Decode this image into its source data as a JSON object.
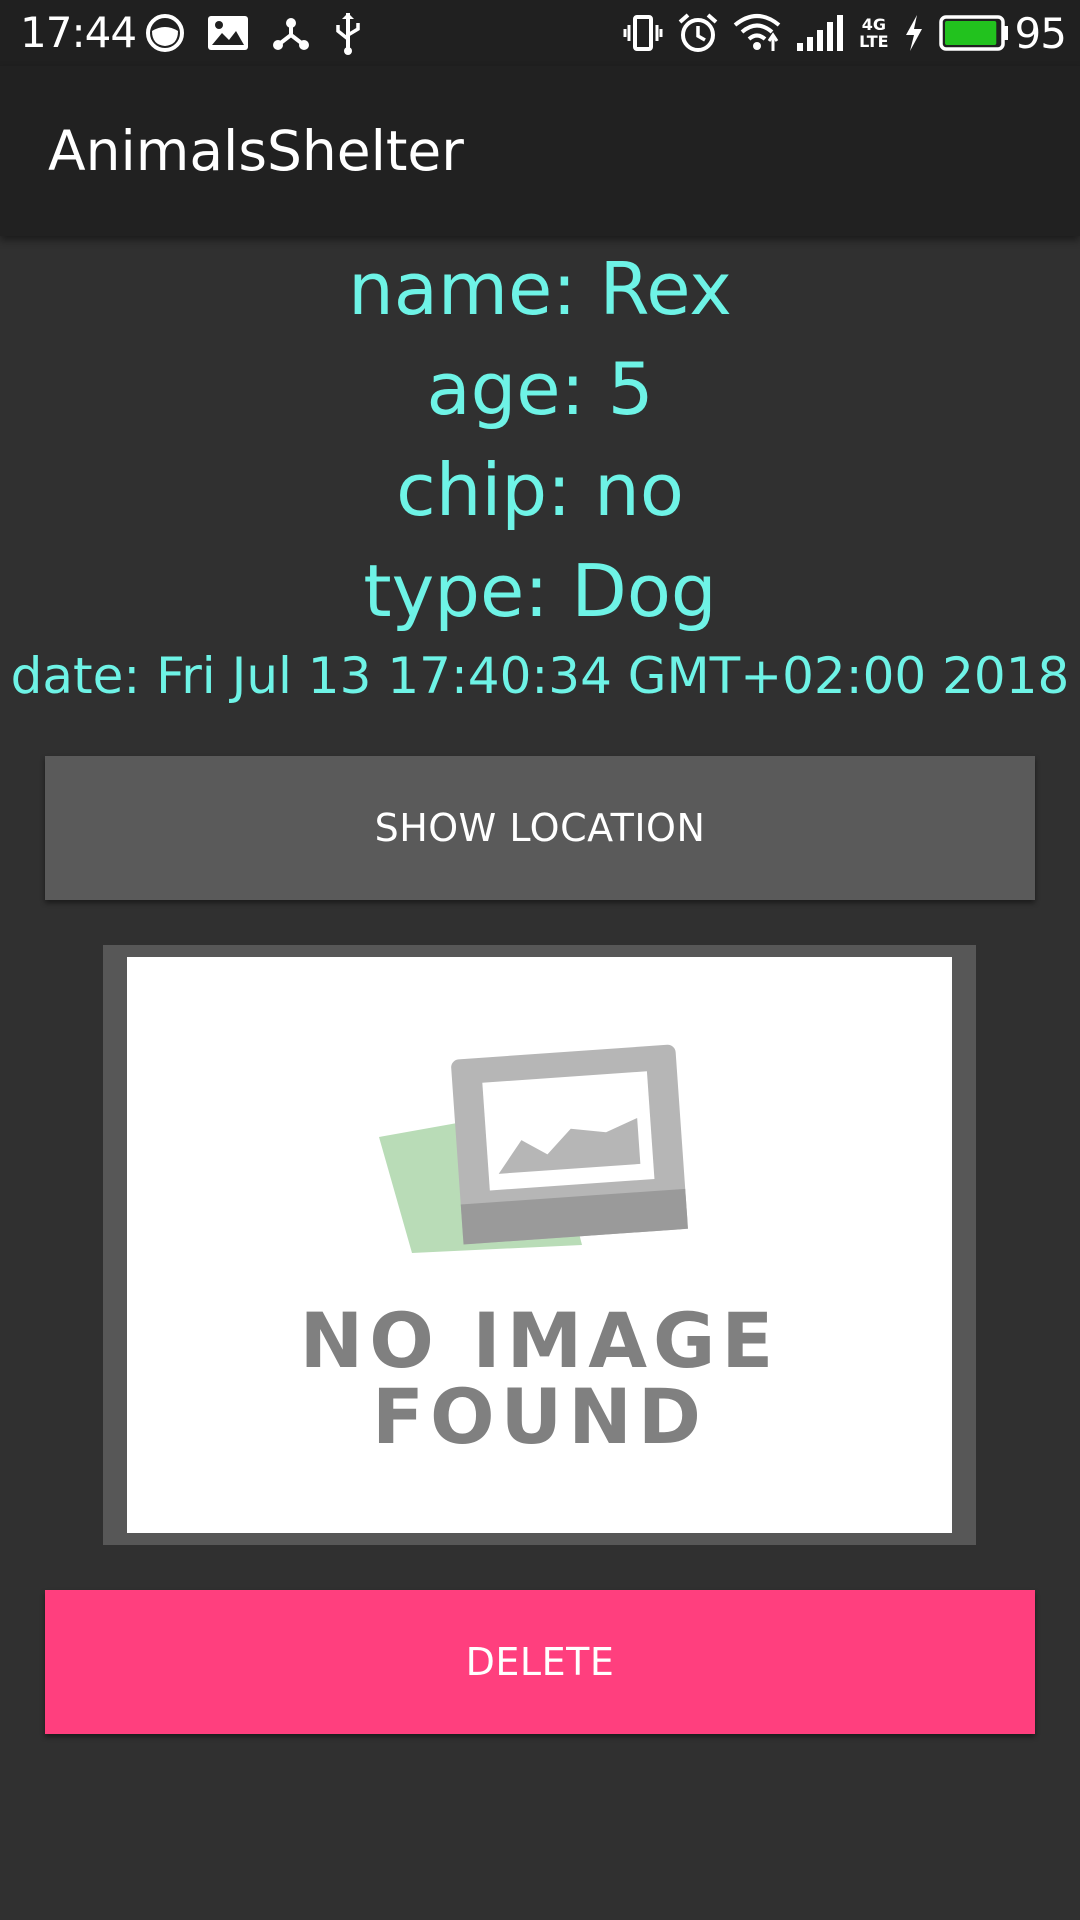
{
  "status_bar": {
    "time": "17:44",
    "battery_percent": "95",
    "left_icons": [
      "mask-icon",
      "image-icon",
      "share-node-icon",
      "usb-icon"
    ],
    "right_icons": [
      "vibrate-icon",
      "alarm-icon",
      "wifi-icon",
      "signal-icon",
      "lte-icon",
      "charging-icon",
      "battery-icon"
    ],
    "network_label_top": "4G",
    "network_label_bottom": "LTE",
    "battery_color": "#22c21e"
  },
  "app_bar": {
    "title": "AnimalsShelter"
  },
  "animal": {
    "name": "name: Rex",
    "age": "age: 5",
    "chip": "chip: no",
    "type": "type: Dog",
    "date": "date: Fri Jul 13 17:40:34 GMT+02:00 2018"
  },
  "actions": {
    "show_location_label": "SHOW LOCATION",
    "delete_label": "DELETE"
  },
  "photo": {
    "placeholder_line1": "NO IMAGE",
    "placeholder_line2": "FOUND"
  },
  "colors": {
    "accent_text": "#6ef3e6",
    "delete_button": "#ff3f7e",
    "location_button": "#5a5a5a",
    "background": "#303030"
  }
}
